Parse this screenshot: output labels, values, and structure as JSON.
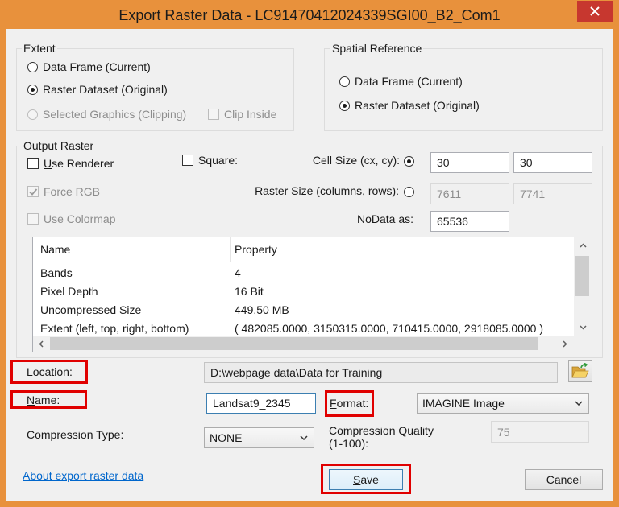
{
  "window": {
    "title": "Export Raster Data - LC91470412024339SGI00_B2_Com1",
    "frame_color": "#E8913C",
    "close_button_color": "#C7372F"
  },
  "icons": {
    "close": "close-icon",
    "browse": "folder-open-icon",
    "dropdown": "chevron-down-icon",
    "scroll_up": "chevron-up-icon",
    "scroll_down": "chevron-down-icon",
    "scroll_left": "chevron-left-icon",
    "scroll_right": "chevron-right-icon",
    "checkmark": "checkmark-icon"
  },
  "extent": {
    "label": "Extent",
    "data_frame": {
      "label": "Data Frame (Current)",
      "checked": false
    },
    "raster_dataset": {
      "label": "Raster Dataset (Original)",
      "checked": true
    },
    "selected_graphics": {
      "label": "Selected Graphics (Clipping)",
      "checked": false,
      "enabled": false
    },
    "clip_inside": {
      "label": "Clip Inside",
      "checked": false,
      "enabled": false
    }
  },
  "spatial_reference": {
    "label": "Spatial Reference",
    "data_frame": {
      "label": "Data Frame (Current)",
      "checked": false
    },
    "raster_dataset": {
      "label": "Raster Dataset (Original)",
      "checked": true
    }
  },
  "output_raster": {
    "label": "Output Raster",
    "use_renderer": {
      "label": "Use Renderer",
      "checked": false
    },
    "square": {
      "label": "Square:",
      "checked": false
    },
    "force_rgb": {
      "label": "Force RGB",
      "checked": true,
      "enabled": false
    },
    "use_colormap": {
      "label": "Use Colormap",
      "checked": false,
      "enabled": false
    },
    "cell_size": {
      "label": "Cell Size (cx, cy):",
      "selected": true,
      "cx": "30",
      "cy": "30"
    },
    "raster_size": {
      "label": "Raster Size (columns, rows):",
      "selected": false,
      "columns": "7611",
      "rows": "7741",
      "fields_enabled": false
    },
    "nodata": {
      "label": "NoData as:",
      "value": "65536"
    },
    "properties": {
      "columns": [
        "Name",
        "Property"
      ],
      "rows": [
        [
          "Bands",
          "4"
        ],
        [
          "Pixel Depth",
          "16 Bit"
        ],
        [
          "Uncompressed Size",
          "449.50 MB"
        ],
        [
          "Extent (left, top, right, bottom)",
          "( 482085.0000, 3150315.0000, 710415.0000, 2918085.0000 )"
        ]
      ]
    }
  },
  "location": {
    "label": "Location:",
    "value": "D:\\webpage data\\Data for Training"
  },
  "name": {
    "label": "Name:",
    "value": "Landsat9_2345"
  },
  "format": {
    "label": "Format:",
    "selected": "IMAGINE Image"
  },
  "compression_type": {
    "label": "Compression Type:",
    "selected": "NONE"
  },
  "compression_quality": {
    "label": "Compression Quality (1-100):",
    "value": "75",
    "enabled": false
  },
  "about_link": {
    "label": "About export raster data"
  },
  "buttons": {
    "save": "Save",
    "cancel": "Cancel"
  },
  "highlight_color": "#E00000"
}
